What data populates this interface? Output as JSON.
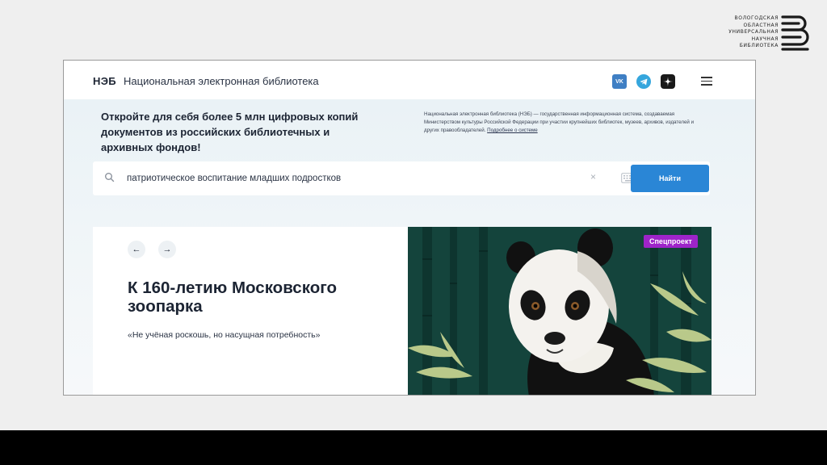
{
  "library_logo": {
    "lines": [
      "ВОЛОГОДСКАЯ",
      "ОБЛАСТНАЯ",
      "УНИВЕРСАЛЬНАЯ",
      "НАУЧНАЯ",
      "БИБЛИОТЕКА"
    ]
  },
  "header": {
    "brand": "НЭБ",
    "brand_full": "Национальная электронная библиотека",
    "social": {
      "vk": "VK"
    }
  },
  "hero": {
    "title": "Откройте для себя более 5 млн цифровых копий документов из российских библиотечных и архивных фондов!",
    "description": "Национальная электронная библиотека (НЭБ) — государственная информационная система, создаваемая Министерством культуры Российской Федерации при участии крупнейших библиотек, музеев, архивов, издателей и других правообладателей.",
    "link": "Подробнее о системе"
  },
  "search": {
    "value": "патриотическое воспитание младших подростков",
    "clear": "×",
    "button": "Найти"
  },
  "slide": {
    "prev": "←",
    "next": "→",
    "title": "К 160-летию Московского зоопарка",
    "quote": "«Не учёная роскошь, но насущная потребность»",
    "badge": "Спецпроект"
  },
  "colors": {
    "accent": "#2a86d6",
    "badge": "#9e24c9",
    "text": "#1c2433"
  }
}
